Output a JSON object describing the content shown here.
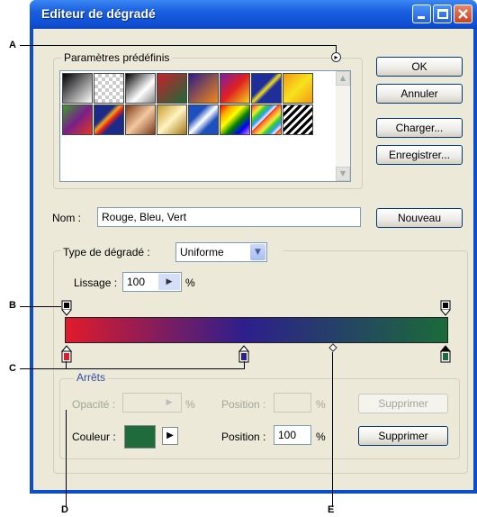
{
  "window": {
    "title": "Editeur de dégradé"
  },
  "presets": {
    "legend": "Paramètres prédéfinis",
    "menu_glyph": "▸"
  },
  "buttons": {
    "ok": "OK",
    "cancel": "Annuler",
    "load": "Charger...",
    "save": "Enregistrer...",
    "new": "Nouveau"
  },
  "name": {
    "label": "Nom :",
    "value": "Rouge, Bleu, Vert"
  },
  "gradient_type": {
    "label": "Type de dégradé :",
    "value": "Uniforme"
  },
  "smoothness": {
    "label": "Lissage :",
    "value": "100",
    "unit": "%"
  },
  "stops": {
    "legend": "Arrêts",
    "opacity_label": "Opacité :",
    "opacity_unit": "%",
    "opacity_position_label": "Position :",
    "opacity_position_unit": "%",
    "delete_opacity": "Supprimer",
    "color_label": "Couleur :",
    "color_value": "#1f6b3c",
    "color_position_label": "Position :",
    "color_position_value": "100",
    "color_position_unit": "%",
    "delete_color": "Supprimer"
  },
  "callouts": {
    "a": "A",
    "b": "B",
    "c": "C",
    "d": "D",
    "e": "E"
  },
  "colors": {
    "red": "#e01b2b",
    "blue": "#2d1f8c",
    "green": "#1b6b3a"
  }
}
